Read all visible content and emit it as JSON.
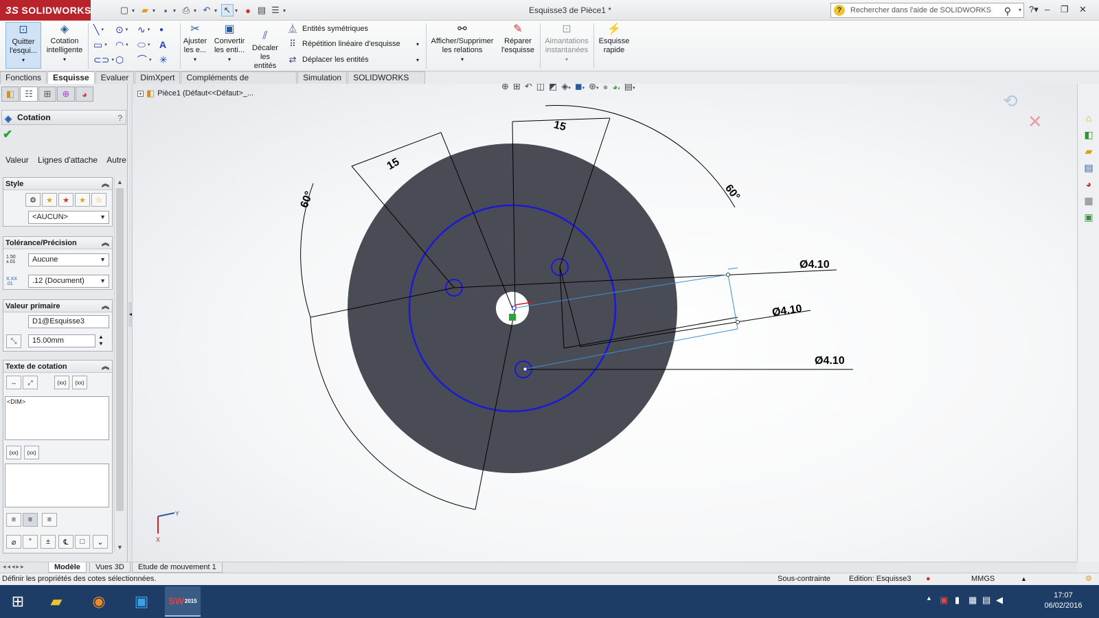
{
  "app": {
    "brand": "SOLIDWORKS",
    "document_title": "Esquisse3 de Pièce1 *",
    "help_search_placeholder": "Rechercher dans l'aide de SOLIDWORKS"
  },
  "ribbon": {
    "quit_sketch": "Quitter l'esqui...",
    "smart_dimension": "Cotation intelligente",
    "trim": "Ajuster les e...",
    "convert": "Convertir les enti...",
    "offset": "Décaler les entités",
    "mirror": "Entités symétriques",
    "linear_pattern": "Répétition linéaire d'esquisse",
    "move": "Déplacer les entités",
    "relations": "Afficher/Supprimer les relations",
    "repair": "Réparer l'esquisse",
    "snaps": "Aimantations instantanées",
    "rapid": "Esquisse rapide"
  },
  "tabs": [
    "Fonctions",
    "Esquisse",
    "Evaluer",
    "DimXpert",
    "Compléments de SOLIDWORKS",
    "Simulation",
    "SOLIDWORKS MBD"
  ],
  "property_manager": {
    "title": "Cotation",
    "help": "?",
    "subtabs": [
      "Valeur",
      "Lignes d'attache",
      "Autre"
    ],
    "style": {
      "header": "Style",
      "selected": "<AUCUN>"
    },
    "tolerance": {
      "header": "Tolérance/Précision",
      "tolerance_type": "Aucune",
      "precision": ".12 (Document)"
    },
    "primary_value": {
      "header": "Valeur primaire",
      "name": "D1@Esquisse3",
      "value": "15.00mm"
    },
    "dim_text": {
      "header": "Texte de cotation",
      "content": "<DIM>",
      "xx1": "(xx)",
      "xx2": "(xx)"
    }
  },
  "feature_tree": {
    "root": "Pièce1  (Défaut<<Défaut>_..."
  },
  "sketch": {
    "dimensions": {
      "linear_1": "15",
      "linear_2": "15",
      "angle_1": "60°",
      "angle_2": "60°",
      "dia_1": "Ø4.10",
      "dia_2": "Ø4.10",
      "dia_3": "Ø4.10"
    },
    "colors": {
      "part": "#4a4c55",
      "sketch": "#1a1ad6",
      "dim": "#000000",
      "preview": "#3a8fd6"
    }
  },
  "bottom_tabs": [
    "Modèle",
    "Vues 3D",
    "Etude de mouvement 1"
  ],
  "status": {
    "message": "Définir les propriétés des cotes sélectionnées.",
    "constraint": "Sous-contrainte",
    "editing": "Edition: Esquisse3",
    "units": "MMGS"
  },
  "taskbar": {
    "time": "17:07",
    "date": "06/02/2016",
    "sw_badge": "2015"
  }
}
